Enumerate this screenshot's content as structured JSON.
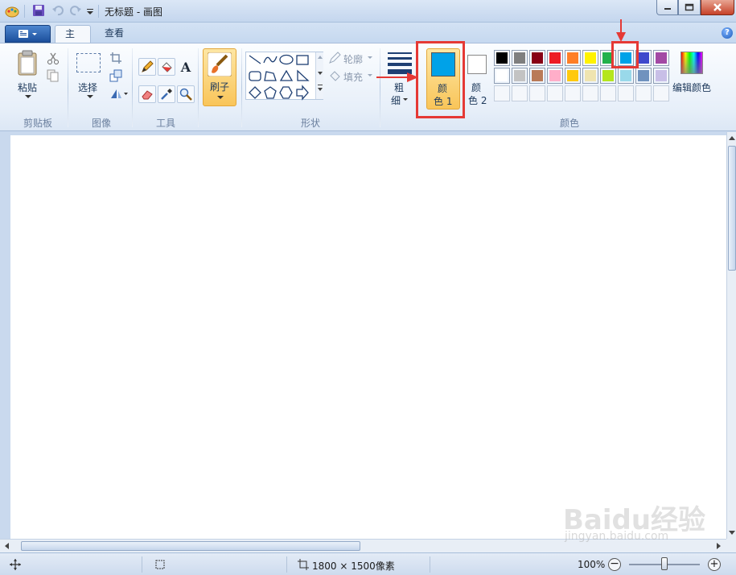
{
  "window": {
    "title": "无标题 - 画图"
  },
  "tabs": [
    {
      "label": "主页"
    },
    {
      "label": "查看"
    }
  ],
  "ribbon": {
    "clipboard": {
      "paste_label": "粘贴",
      "group_label": "剪贴板"
    },
    "image": {
      "select_label": "选择",
      "group_label": "图像"
    },
    "tools": {
      "group_label": "工具"
    },
    "brushes": {
      "label": "刷子"
    },
    "shapes": {
      "outline_label": "轮廓",
      "fill_label": "填充",
      "group_label": "形状"
    },
    "size": {
      "label_line1": "粗",
      "label_line2": "细"
    },
    "colors": {
      "color1_line1": "颜",
      "color1_line2": "色 1",
      "color2_line1": "颜",
      "color2_line2": "色 2",
      "edit_colors_label": "编辑颜色",
      "group_label": "颜色",
      "color1_value": "#00a2e8",
      "color2_value": "#ffffff",
      "palette_row1": [
        "#000000",
        "#7f7f7f",
        "#880015",
        "#ed1c24",
        "#ff7f27",
        "#fff200",
        "#22b14c",
        "#00a2e8",
        "#3f48cc",
        "#a349a4"
      ],
      "palette_row2": [
        "#ffffff",
        "#c3c3c3",
        "#b97a57",
        "#ffaec9",
        "#ffc90e",
        "#efe4b0",
        "#b5e61d",
        "#99d9ea",
        "#7092be",
        "#c8bfe7"
      ],
      "palette_row3": [
        "#f4f7fb",
        "#f4f7fb",
        "#f4f7fb",
        "#f4f7fb",
        "#f4f7fb",
        "#f4f7fb",
        "#f4f7fb",
        "#f4f7fb",
        "#f4f7fb",
        "#f4f7fb"
      ],
      "selected_palette_color": "#00a2e8"
    }
  },
  "statusbar": {
    "image_size": "1800 × 1500像素",
    "zoom": "100%"
  },
  "watermark": {
    "text": "Baidu经验",
    "url": "jingyan.baidu.com"
  }
}
